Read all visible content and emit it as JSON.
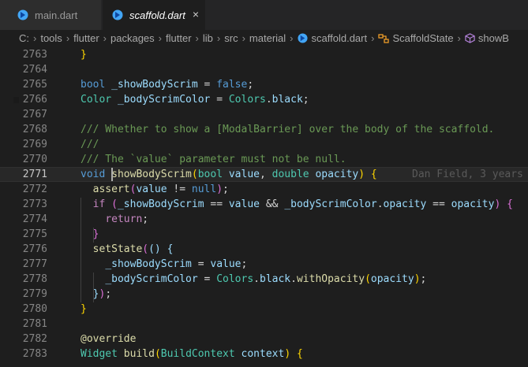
{
  "tabs": [
    {
      "label": "main.dart",
      "icon": "dart-icon",
      "active": false
    },
    {
      "label": "scaffold.dart",
      "icon": "dart-icon",
      "active": true,
      "close": "×"
    }
  ],
  "breadcrumb": [
    "C:",
    "tools",
    "flutter",
    "packages",
    "flutter",
    "lib",
    "src",
    "material",
    "scaffold.dart",
    "ScaffoldState",
    "showB"
  ],
  "breadcrumb_icons": {
    "file": "dart-icon",
    "class": "class-symbol-icon",
    "method": "method-symbol-icon"
  },
  "editor": {
    "active_line": "2771",
    "blame": "Dan Field, 3 years",
    "lines": [
      {
        "n": "2763",
        "code": "}"
      },
      {
        "n": "2764",
        "code": ""
      },
      {
        "n": "2765",
        "code": "bool _showBodyScrim = false;"
      },
      {
        "n": "2766",
        "code": "Color _bodyScrimColor = Colors.black;"
      },
      {
        "n": "2767",
        "code": ""
      },
      {
        "n": "2768",
        "code": "/// Whether to show a [ModalBarrier] over the body of the scaffold."
      },
      {
        "n": "2769",
        "code": "///"
      },
      {
        "n": "2770",
        "code": "/// The `value` parameter must not be null."
      },
      {
        "n": "2771",
        "code": "void showBodyScrim(bool value, double opacity) {"
      },
      {
        "n": "2772",
        "code": "  assert(value != null);"
      },
      {
        "n": "2773",
        "code": "  if (_showBodyScrim == value && _bodyScrimColor.opacity == opacity) {"
      },
      {
        "n": "2774",
        "code": "    return;"
      },
      {
        "n": "2775",
        "code": "  }"
      },
      {
        "n": "2776",
        "code": "  setState(() {"
      },
      {
        "n": "2777",
        "code": "    _showBodyScrim = value;"
      },
      {
        "n": "2778",
        "code": "    _bodyScrimColor = Colors.black.withOpacity(opacity);"
      },
      {
        "n": "2779",
        "code": "  });"
      },
      {
        "n": "2780",
        "code": "}"
      },
      {
        "n": "2781",
        "code": ""
      },
      {
        "n": "2782",
        "code": "@override"
      },
      {
        "n": "2783",
        "code": "Widget build(BuildContext context) {"
      }
    ]
  },
  "colors": {
    "keyword": "#569cd6",
    "type": "#4ec9b0",
    "function": "#dcdcaa",
    "variable": "#9cdcfe",
    "comment": "#6a9955",
    "control": "#c586c0"
  }
}
